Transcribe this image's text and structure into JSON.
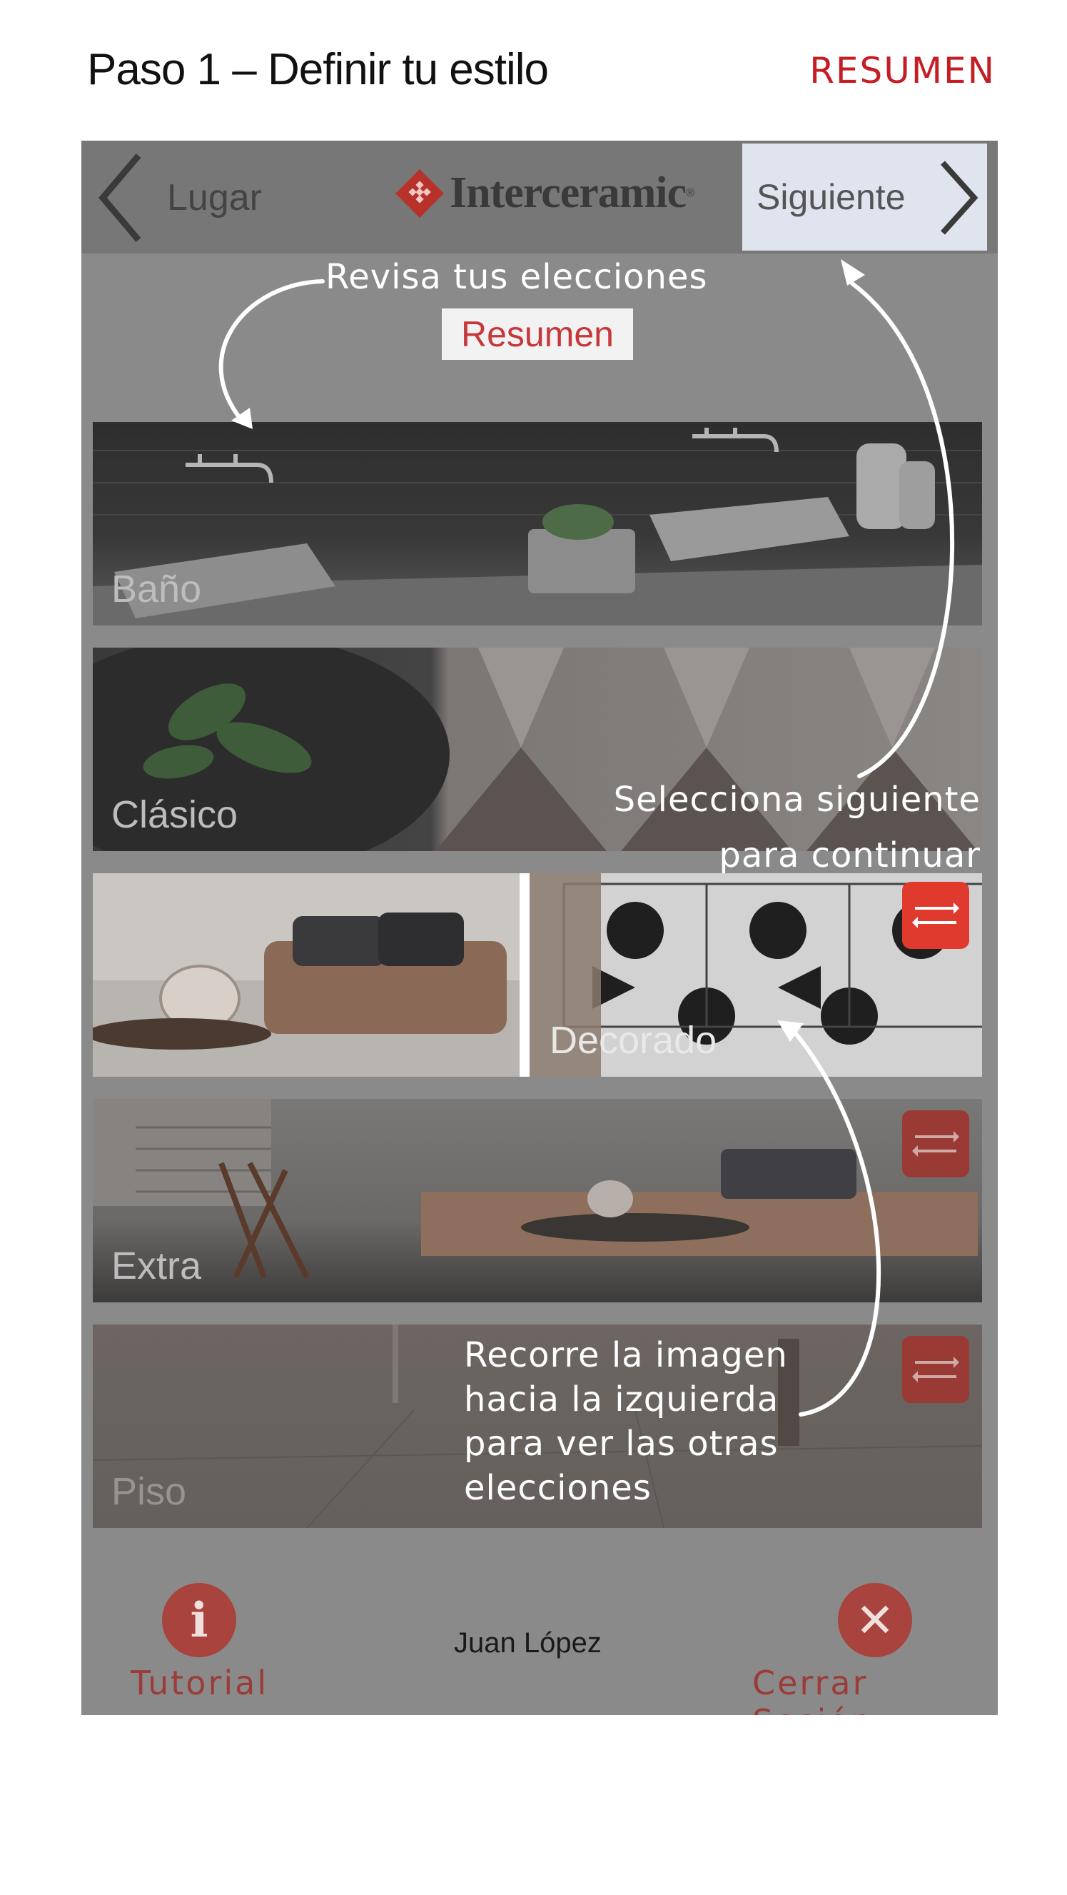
{
  "page": {
    "title": "Paso 1 – Definir tu estilo",
    "resumen_link": "RESUMEN"
  },
  "navbar": {
    "back_label": "Lugar",
    "logo_text": "Interceramic",
    "logo_reg": "®",
    "next_label": "Siguiente"
  },
  "annotations": {
    "review": "Revisa tus elecciones",
    "summary_button": "Resumen",
    "next_line1": "Selecciona siguiente",
    "next_line2": "para continuar",
    "swipe_line1": "Recorre la imagen",
    "swipe_line2": "hacia la izquierda",
    "swipe_line3": "para ver las otras",
    "swipe_line4": "elecciones"
  },
  "tiles": [
    {
      "label": "Baño",
      "swap_icon": false
    },
    {
      "label": "Clásico",
      "swap_icon": false
    },
    {
      "label": "Decorado",
      "swap_icon": true
    },
    {
      "label": "Extra",
      "swap_icon": true
    },
    {
      "label": "Piso",
      "swap_icon": true
    }
  ],
  "bottom": {
    "tutorial_label": "Tutorial",
    "tutorial_icon": "info-icon",
    "user_name": "Juan López",
    "logout_label": "Cerrar Sesión",
    "logout_icon": "close-icon"
  },
  "colors": {
    "accent_red": "#c41e24",
    "overlay_gray": "#8a8a8a",
    "next_highlight": "#dfe4ee"
  }
}
